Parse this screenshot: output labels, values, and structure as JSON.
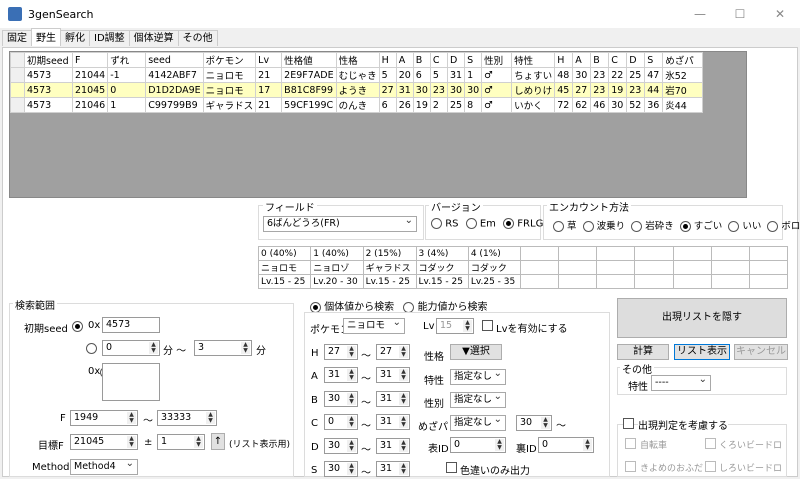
{
  "window": {
    "title": "3genSearch",
    "controls": [
      "—",
      "☐",
      "✕"
    ]
  },
  "tabs": [
    "固定",
    "野生",
    "孵化",
    "ID調整",
    "個体逆算",
    "その他"
  ],
  "grid": {
    "headers": [
      "初期seed",
      "F",
      "ずれ",
      "seed",
      "ポケモン",
      "Lv",
      "性格値",
      "性格",
      "H",
      "A",
      "B",
      "C",
      "D",
      "S",
      "性別",
      "特性",
      "H",
      "A",
      "B",
      "C",
      "D",
      "S",
      "めざパ"
    ],
    "rows": [
      [
        "4573",
        "21044",
        "-1",
        "4142ABF7",
        "ニョロモ",
        "21",
        "2E9F7ADE",
        "むじゃき",
        "5",
        "20",
        "6",
        "5",
        "31",
        "1",
        "♂",
        "ちょすい",
        "48",
        "30",
        "23",
        "22",
        "25",
        "47",
        "氷52"
      ],
      [
        "4573",
        "21045",
        "0",
        "D1D2DA9E",
        "ニョロモ",
        "17",
        "B81C8F99",
        "ようき",
        "27",
        "31",
        "30",
        "23",
        "30",
        "30",
        "♂",
        "しめりけ",
        "45",
        "27",
        "23",
        "19",
        "23",
        "44",
        "岩70"
      ],
      [
        "4573",
        "21046",
        "1",
        "C99799B9",
        "ギャラドス",
        "21",
        "59CF199C",
        "のんき",
        "6",
        "26",
        "19",
        "2",
        "25",
        "8",
        "♂",
        "いかく",
        "72",
        "62",
        "46",
        "30",
        "52",
        "36",
        "炎44"
      ]
    ]
  },
  "field": {
    "label": "フィールド",
    "value": "6ばんどうろ(FR)"
  },
  "version": {
    "label": "バージョン",
    "options": [
      "RS",
      "Em",
      "FRLG"
    ],
    "selected": "FRLG"
  },
  "encounter": {
    "label": "エンカウント方法",
    "options": [
      "草",
      "波乗り",
      "岩砕き",
      "すごい",
      "いい",
      "ボロ"
    ],
    "selected": "すごい"
  },
  "slots": {
    "headers": [
      "0 (40%)",
      "1 (40%)",
      "2 (15%)",
      "3 (4%)",
      "4 (1%)"
    ],
    "pokemon": [
      "ニョロモ",
      "ニョロゾ",
      "ギャラドス",
      "コダック",
      "コダック"
    ],
    "levels": [
      "Lv.15 - 25",
      "Lv.20 - 30",
      "Lv.15 - 25",
      "Lv.15 - 25",
      "Lv.25 - 35"
    ]
  },
  "search_range": {
    "label": "検索範囲",
    "initial_seed_label": "初期seed",
    "hex_prefix": "0x",
    "seed_value": "4573",
    "min_value": "0",
    "min_unit": "分 〜",
    "sec_value": "3",
    "sec_unit": "分",
    "f_label": "F",
    "f_from": "1949",
    "tilde": "〜",
    "f_to": "33333",
    "target_label": "目標F",
    "target_value": "21045",
    "pm": "±",
    "range_value": "1",
    "up_arrow": "↑",
    "list_note": "(リスト表示用)",
    "method_label": "Method",
    "method_value": "Method4"
  },
  "mode": {
    "options": [
      "個体値から検索",
      "能力値から検索"
    ],
    "selected": "個体値から検索"
  },
  "pokemon": {
    "label": "ポケモン",
    "value": "ニョロモ",
    "lv_label": "Lv",
    "lv_value": "15",
    "lv_check": "Lvを有効にする"
  },
  "ivs": [
    {
      "stat": "H",
      "from": "27",
      "to": "27"
    },
    {
      "stat": "A",
      "from": "31",
      "to": "31"
    },
    {
      "stat": "B",
      "from": "30",
      "to": "31"
    },
    {
      "stat": "C",
      "from": "0",
      "to": "31"
    },
    {
      "stat": "D",
      "from": "30",
      "to": "31"
    },
    {
      "stat": "S",
      "from": "30",
      "to": "31"
    }
  ],
  "filters": {
    "nature_label": "性格",
    "nature_btn": "▼選択",
    "ability_label": "特性",
    "ability_value": "指定なし",
    "gender_label": "性別",
    "gender_value": "指定なし",
    "hp_label": "めざパ",
    "hp_value": "指定なし",
    "hp_power": "30",
    "hp_tilde": "〜",
    "tid_label": "表ID",
    "tid_value": "0",
    "sid_label": "裏ID",
    "sid_value": "0",
    "shiny_label": "色違いのみ出力"
  },
  "buttons": {
    "hide_list": "出現リストを隠す",
    "calc": "計算",
    "list": "リスト表示",
    "cancel": "キャンセル"
  },
  "other": {
    "label": "その他",
    "ability_label": "特性",
    "ability_value": "----"
  },
  "appearance": {
    "label": "出現判定を考慮する",
    "options": [
      "自転車",
      "くろいビードロ",
      "きよめのおふだ",
      "しろいビードロ"
    ]
  },
  "colors": {
    "highlight": "#ffffc0",
    "grid_bg": "#a0a0a0"
  }
}
